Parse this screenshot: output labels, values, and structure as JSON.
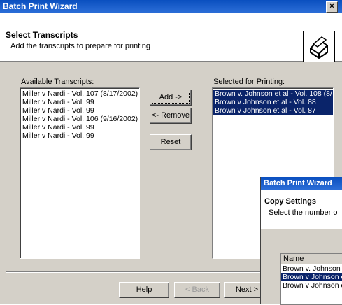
{
  "window": {
    "title": "Batch Print Wizard",
    "close_label": "×"
  },
  "header": {
    "title": "Select Transcripts",
    "subtitle": "Add the transcripts to prepare for printing"
  },
  "available": {
    "label": "Available Transcripts:",
    "items": [
      "Miller v Nardi - Vol. 107 (8/17/2002)",
      "Miller v Nardi - Vol. 99",
      "Miller v Nardi - Vol. 99",
      "Miller v Nardi - Vol. 106 (9/16/2002)",
      "Miller v Nardi - Vol. 99",
      "Miller v Nardi - Vol. 99"
    ]
  },
  "selected": {
    "label": "Selected for Printing:",
    "items": [
      "Brown v. Johnson et al - Vol. 108 (8/",
      "Brown v Johnson et al - Vol. 88",
      "Brown v Johnson et al - Vol. 87"
    ]
  },
  "buttons": {
    "add": "Add ->",
    "remove": "<- Remove",
    "reset": "Reset",
    "help": "Help",
    "back": "< Back",
    "next": "Next >"
  },
  "copy_window": {
    "title": "Batch Print Wizard",
    "heading": "Copy Settings",
    "subtitle": "Select the number o",
    "column_name": "Name",
    "rows": [
      "Brown v. Johnson",
      "Brown v Johnson e",
      "Brown v Johnson e"
    ]
  }
}
